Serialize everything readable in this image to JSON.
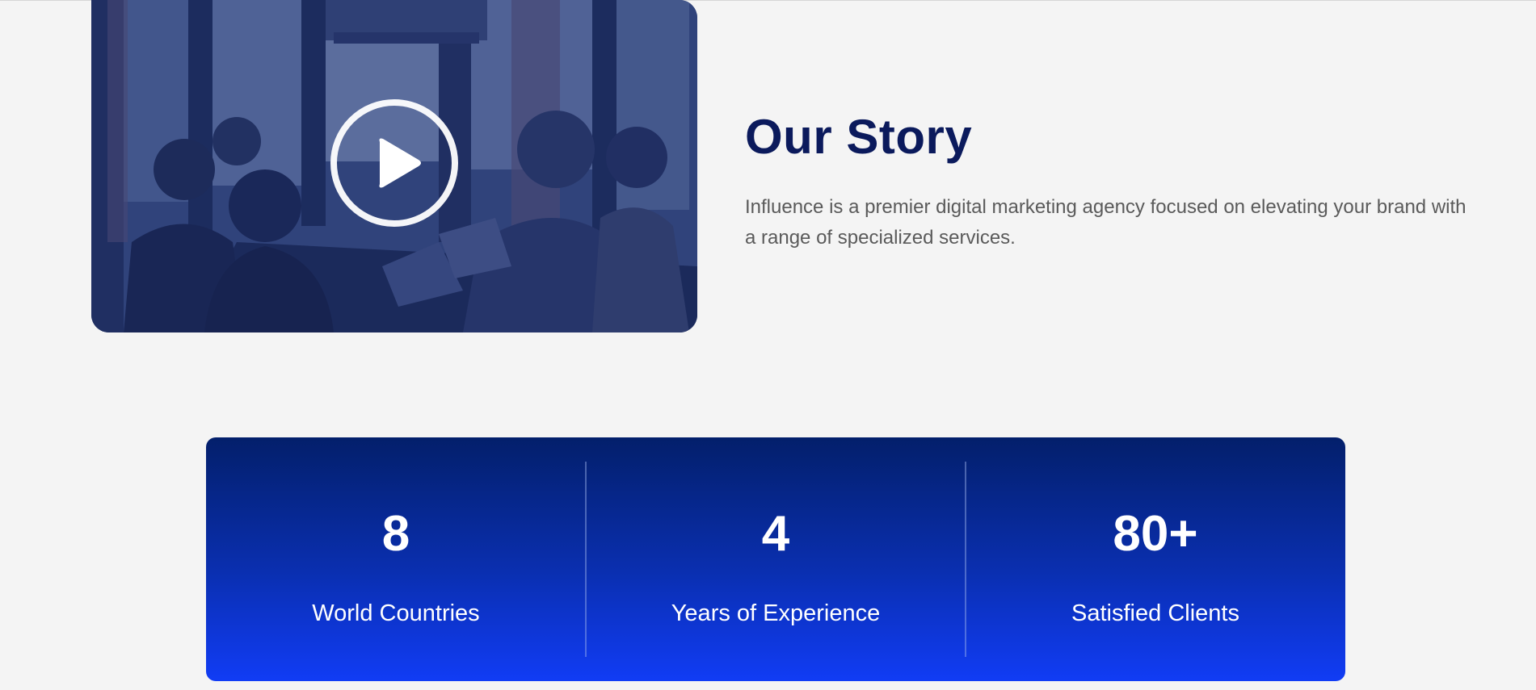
{
  "story": {
    "title": "Our Story",
    "description": "Influence is a premier digital marketing agency focused on elevating your brand with a range of specialized services.",
    "image_icon": "play-icon",
    "overlay_color": "#1c2f6b"
  },
  "stats": {
    "items": [
      {
        "value": "8",
        "label": "World Countries"
      },
      {
        "value": "4",
        "label": "Years of Experience"
      },
      {
        "value": "80+",
        "label": "Satisfied Clients"
      }
    ],
    "gradient_top": "#031f6b",
    "gradient_bottom": "#113cf5"
  },
  "colors": {
    "page_bg": "#f4f4f4",
    "title": "#0b1a5c",
    "body_text": "#5a5a5a"
  }
}
